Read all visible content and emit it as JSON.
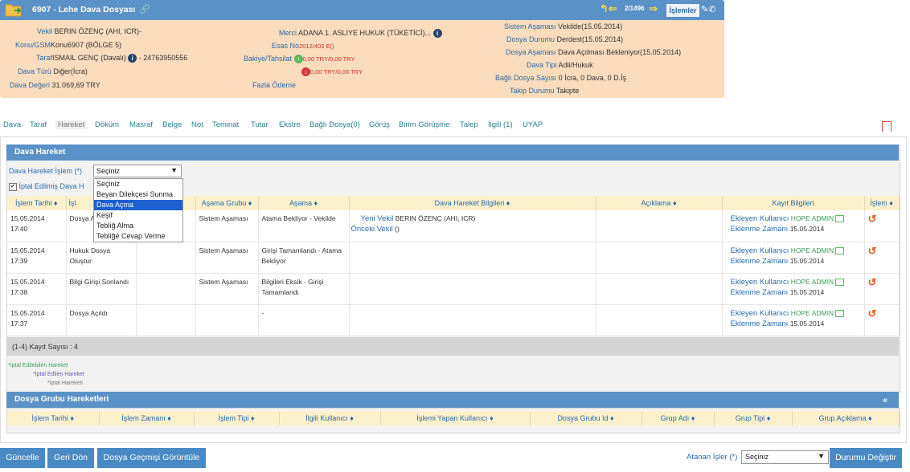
{
  "header": {
    "title": "6907 - Lehe Dava Dosyası",
    "pagination": "2/1496",
    "islemler": "İşlemler",
    "left": {
      "vekil_label": "Vekil",
      "vekil_value": "BERIN ÖZENÇ (AHI, ICR)-",
      "konu_label": "Konu/GSM",
      "konu_value": "Konu6907 (BÖLGE 5)",
      "taraf_label": "Taraf",
      "taraf_value": "ISMAIL GENÇ (Davalı)",
      "taraf_phone": "- 24763950556",
      "dava_turu_label": "Dava Türü",
      "dava_turu_value": "Diğer(İcra)",
      "dava_degeri_label": "Dava Değeri",
      "dava_degeri_value": "31.069,69 TRY"
    },
    "middle": {
      "merci_label": "Merci",
      "merci_value": "ADANA 1. ASLIYE HUKUK (TÜKETİCİ)...",
      "esas_label": "Esas No",
      "esas_value": "2012/403 E()",
      "bakiye_label": "Bakiye/Tahsilat",
      "bakiye_up": "0,00 TRY/0,00 TRY",
      "bakiye_down": "0,00 TRY/0,00 TRY",
      "fazla_label": "Fazla Ödeme"
    },
    "right": {
      "sistem_label": "Sistem Aşaması",
      "sistem_value": "Vekilde(15.05.2014)",
      "durum_label": "Dosya Durumu",
      "durum_value": "Derdest(15.05.2014)",
      "asama_label": "Dosya Aşaması",
      "asama_value": "Dava Açılması Bekleniyor(15.05.2014)",
      "tipi_label": "Dava Tipi",
      "tipi_value": "Adli/Hukuk",
      "bagli_label": "Bağlı Dosya Sayısı",
      "bagli_value": "0 İcra, 0 Dava, 0 D.İş",
      "takip_label": "Takip Durumu",
      "takip_value": "Takipte"
    }
  },
  "tabs": [
    "Dava",
    "Taraf",
    "Hareket",
    "Döküm",
    "Masraf",
    "Belge",
    "Not",
    "Teminat",
    "Tutar",
    "Ekstre",
    "Bağlı Dosya(0)",
    "Görüş",
    "Birim Görüşme",
    "Talep",
    "İlgili (1)",
    "UYAP"
  ],
  "active_tab": "Hareket",
  "dava_hareket": {
    "panel_title": "Dava Hareket",
    "islem_label": "Dava Hareket İşlem (*)",
    "islem_value": "Seçiniz",
    "iptal_checkbox_label": "İptal Edilmiş Dava H",
    "dropdown_options": [
      "Seçiniz",
      "Beyan Dilekçesi Sunma",
      "Dava Açma",
      "Keşif",
      "Tebliğ Alma",
      "Tebliğe Cevap Verme"
    ],
    "dropdown_selected": "Dava Açma",
    "columns": [
      "İşlem Tarihi",
      "İşl",
      "",
      "Aşama Grubu",
      "Aşama",
      "Dava Hareket Bilgileri",
      "Açıklama",
      "Kayıt Bilgileri",
      "İşlem"
    ],
    "rows": [
      {
        "tarih": "15.05.2014",
        "saat": "17:40",
        "islem": "Dosya A",
        "grup": "Sistem Aşaması",
        "asama": "Atama Bekliyor - Vekilde",
        "bilgi1_label": "Yeni Vekil",
        "bilgi1_value": "BERIN ÖZENÇ (AHI, ICR)",
        "bilgi2_label": "Önceki Vekil",
        "bilgi2_value": "()",
        "ekleyen_label": "Ekleyen Kullanıcı",
        "ekleyen_value": "HOPE ADMIN",
        "zaman_label": "Eklenme Zamanı",
        "zaman_value": "15.05.2014"
      },
      {
        "tarih": "15.05.2014",
        "saat": "17:39",
        "islem": "Hukuk Dosya Oluştur",
        "grup": "Sistem Aşaması",
        "asama": "Girişi Tamamlandı - Atama Bekliyor",
        "bilgi1_label": "",
        "bilgi1_value": "",
        "bilgi2_label": "",
        "bilgi2_value": "",
        "ekleyen_label": "Ekleyen Kullanıcı",
        "ekleyen_value": "HOPE ADMIN",
        "zaman_label": "Eklenme Zamanı",
        "zaman_value": "15.05.2014"
      },
      {
        "tarih": "15.05.2014",
        "saat": "17:38",
        "islem": "Bilgi Girişi Sonlandı",
        "grup": "Sistem Aşaması",
        "asama": "Bilgileri Eksik - Girişi Tamamlandı",
        "bilgi1_label": "",
        "bilgi1_value": "",
        "bilgi2_label": "",
        "bilgi2_value": "",
        "ekleyen_label": "Ekleyen Kullanıcı",
        "ekleyen_value": "HOPE ADMIN",
        "zaman_label": "Eklenme Zamanı",
        "zaman_value": "15.05.2014"
      },
      {
        "tarih": "15.05.2014",
        "saat": "17:37",
        "islem": "Dosya Açıldı",
        "grup": "",
        "asama": "-",
        "bilgi1_label": "",
        "bilgi1_value": "",
        "bilgi2_label": "",
        "bilgi2_value": "",
        "ekleyen_label": "Ekleyen Kullanıcı",
        "ekleyen_value": "HOPE ADMIN",
        "zaman_label": "Eklenme Zamanı",
        "zaman_value": "15.05.2014"
      }
    ],
    "record_count": "(1-4) Kayıt Sayısı : 4",
    "legend": [
      "*İptal Edilebilen Hareket",
      "*İptal Edilen Hareket",
      "*İptal Hareketi"
    ]
  },
  "dosya_grubu": {
    "panel_title": "Dosya Grubu Hareketleri",
    "collapse": "«",
    "columns": [
      "İşlem Tarihi",
      "İşlem Zamanı",
      "İşlem Tipi",
      "İlgili Kullanıcı",
      "İşlemi Yapan Kullanıcı",
      "Dosya Grubu Id",
      "Grup Adı",
      "Grup Tipi",
      "Grup Açıklama"
    ]
  },
  "footer": {
    "guncelle": "Güncelle",
    "geri_don": "Geri Dön",
    "gecmis": "Dosya Geçmişi Görüntüle",
    "atanan_label": "Atanan İşler (*)",
    "atanan_value": "Seçiniz",
    "durum_degistir": "Durumu Değiştir"
  },
  "colors": {
    "header_blue": "#5a91c6",
    "card_bg": "#fbdcbc",
    "label_blue": "#2a6aa8",
    "tab_teal": "#2a7f8f"
  }
}
